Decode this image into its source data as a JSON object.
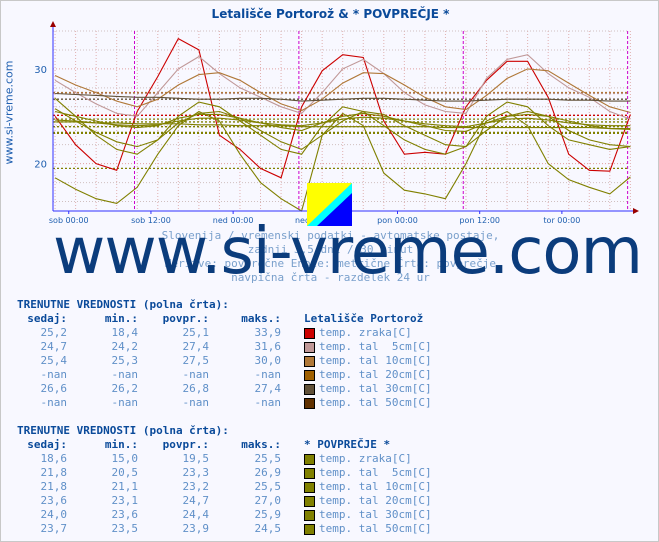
{
  "title": "Letališče Portorož & * POVPREČJE *",
  "side_text": "www.si-vreme.com",
  "watermark": "www.si-vreme.com",
  "captions": [
    "Slovenija / vremenski podatki - avtomatske postaje,",
    "zadnji 3,5 dni / 30 minut",
    "Meritve: povprečne  Enote: metrične  Črta: povprečje",
    "navpična črta - razdelek 24 ur"
  ],
  "chart_data": {
    "type": "line",
    "ylim": [
      15,
      34
    ],
    "yticks": [
      20,
      30
    ],
    "xticks": [
      "sob 00:00",
      "sob 12:00",
      "ned 00:00",
      "ned 12:00",
      "pon 00:00",
      "pon 12:00",
      "tor 00:00"
    ],
    "day_divider_times": [
      "sob 09:36",
      "ned 09:36",
      "pon 09:36",
      "tor 09:36"
    ],
    "grid": true,
    "x": [
      "pet 22:00",
      "sob 01:00",
      "sob 04:00",
      "sob 07:00",
      "sob 10:00",
      "sob 13:00",
      "sob 16:00",
      "sob 19:00",
      "sob 22:00",
      "ned 01:00",
      "ned 04:00",
      "ned 07:00",
      "ned 10:00",
      "ned 13:00",
      "ned 16:00",
      "ned 19:00",
      "ned 22:00",
      "pon 01:00",
      "pon 04:00",
      "pon 07:00",
      "pon 10:00",
      "pon 13:00",
      "pon 16:00",
      "pon 19:00",
      "pon 22:00",
      "tor 01:00",
      "tor 04:00",
      "tor 07:00",
      "tor 10:00"
    ],
    "series": [
      {
        "name": "Letališče Portorož temp. zraka[C]",
        "color": "#cc0000",
        "avg": 25.1,
        "values": [
          25.0,
          22.0,
          20.0,
          19.3,
          25.5,
          29.2,
          33.2,
          32.0,
          23.0,
          21.5,
          19.5,
          18.5,
          26.0,
          29.8,
          31.5,
          31.2,
          24.5,
          21.0,
          21.2,
          21.0,
          26.0,
          28.8,
          30.8,
          30.8,
          27.0,
          21.0,
          19.3,
          19.2,
          25.2
        ]
      },
      {
        "name": "Letališče Portorož temp. tal 5cm[C]",
        "color": "#c09898",
        "avg": 27.4,
        "values": [
          28.8,
          27.5,
          26.3,
          25.3,
          25.0,
          27.5,
          30.0,
          31.3,
          29.5,
          28.0,
          27.0,
          26.0,
          25.3,
          27.5,
          30.0,
          31.0,
          29.5,
          27.5,
          26.2,
          25.5,
          25.3,
          29.0,
          31.0,
          31.5,
          29.5,
          28.0,
          27.0,
          25.5,
          24.7
        ]
      },
      {
        "name": "Letališče Portorož temp. tal 10cm[C]",
        "color": "#b07838",
        "avg": 27.5,
        "values": [
          29.3,
          28.3,
          27.5,
          26.6,
          26.0,
          26.8,
          28.3,
          29.4,
          29.6,
          28.8,
          27.5,
          26.3,
          25.6,
          26.8,
          28.5,
          29.6,
          29.5,
          28.3,
          27.0,
          26.0,
          25.7,
          27.2,
          29.0,
          30.0,
          29.8,
          28.5,
          27.2,
          26.0,
          25.4
        ]
      },
      {
        "name": "Letališče Portorož temp. tal 30cm[C]",
        "color": "#605038",
        "avg": 26.8,
        "values": [
          27.4,
          27.3,
          27.2,
          27.1,
          27.0,
          27.0,
          26.9,
          26.8,
          26.8,
          26.9,
          26.9,
          26.8,
          26.6,
          26.7,
          26.8,
          26.9,
          26.9,
          26.8,
          26.7,
          26.6,
          26.6,
          26.7,
          26.8,
          26.8,
          26.8,
          26.7,
          26.7,
          26.6,
          26.6
        ]
      },
      {
        "name": "* POVPREČJE * temp. zraka[C]",
        "color": "#808000",
        "avg": 19.5,
        "values": [
          18.5,
          17.3,
          16.3,
          15.8,
          17.5,
          21.0,
          24.0,
          25.5,
          24.5,
          21.0,
          18.0,
          16.3,
          15.0,
          23.0,
          25.3,
          24.0,
          19.0,
          17.2,
          16.8,
          16.3,
          20.0,
          24.5,
          25.5,
          24.0,
          20.0,
          18.3,
          17.5,
          16.8,
          18.6
        ]
      },
      {
        "name": "* POVPREČJE * temp. tal 5cm[C]",
        "color": "#808000",
        "avg": 23.3,
        "values": [
          26.9,
          25.0,
          23.0,
          21.5,
          21.0,
          22.5,
          25.0,
          26.5,
          26.0,
          24.5,
          23.0,
          21.5,
          21.0,
          24.0,
          26.0,
          25.5,
          24.0,
          22.5,
          21.5,
          21.0,
          21.8,
          25.0,
          26.5,
          26.0,
          24.0,
          22.5,
          22.0,
          21.5,
          21.8
        ]
      },
      {
        "name": "* POVPREČJE * temp. tal 10cm[C]",
        "color": "#808000",
        "avg": 23.2,
        "values": [
          25.8,
          24.5,
          23.3,
          22.3,
          21.8,
          22.5,
          24.3,
          25.3,
          25.5,
          24.8,
          23.5,
          22.3,
          21.5,
          23.0,
          24.5,
          25.5,
          25.2,
          24.0,
          23.0,
          22.0,
          21.8,
          23.5,
          25.0,
          25.5,
          25.0,
          23.5,
          22.5,
          22.0,
          21.8
        ]
      },
      {
        "name": "* POVPREČJE * temp. tal 20cm[C]",
        "color": "#808000",
        "avg": 24.7,
        "values": [
          25.5,
          25.0,
          24.5,
          24.0,
          23.8,
          24.0,
          24.8,
          25.2,
          25.2,
          24.8,
          24.3,
          23.8,
          23.5,
          24.3,
          25.0,
          25.3,
          25.0,
          24.5,
          24.0,
          23.5,
          23.4,
          24.3,
          25.0,
          25.2,
          25.0,
          24.5,
          24.0,
          23.7,
          23.6
        ]
      },
      {
        "name": "* POVPREČJE * temp. tal 30cm[C]",
        "color": "#808000",
        "avg": 24.4,
        "values": [
          24.6,
          24.5,
          24.3,
          24.1,
          24.0,
          24.1,
          24.5,
          24.8,
          24.8,
          24.6,
          24.3,
          24.1,
          24.0,
          24.3,
          24.7,
          24.9,
          24.8,
          24.5,
          24.2,
          24.0,
          23.9,
          24.3,
          24.7,
          24.8,
          24.6,
          24.3,
          24.1,
          24.0,
          24.0
        ]
      },
      {
        "name": "* POVPREČJE * temp. tal 50cm[C]",
        "color": "#808000",
        "avg": 23.9,
        "values": [
          24.4,
          24.4,
          24.3,
          24.3,
          24.2,
          24.2,
          24.2,
          24.1,
          24.1,
          24.0,
          24.0,
          24.0,
          23.9,
          23.9,
          23.9,
          23.9,
          23.9,
          23.9,
          23.9,
          23.8,
          23.8,
          23.8,
          23.8,
          23.8,
          23.8,
          23.8,
          23.8,
          23.7,
          23.7
        ]
      }
    ]
  },
  "tables": [
    {
      "heading": "TRENUTNE VREDNOSTI (polna črta):",
      "cols": [
        "sedaj:",
        "min.:",
        "povpr.:",
        "maks.:"
      ],
      "station": "Letališče Portorož",
      "rows": [
        [
          "25,2",
          "18,4",
          "25,1",
          "33,9",
          "#cc0000",
          "temp. zraka[C]"
        ],
        [
          "24,7",
          "24,2",
          "27,4",
          "31,6",
          "#c09898",
          "temp. tal  5cm[C]"
        ],
        [
          "25,4",
          "25,3",
          "27,5",
          "30,0",
          "#b07838",
          "temp. tal 10cm[C]"
        ],
        [
          "-nan",
          "-nan",
          "-nan",
          "-nan",
          "#a06000",
          "temp. tal 20cm[C]"
        ],
        [
          "26,6",
          "26,2",
          "26,8",
          "27,4",
          "#605038",
          "temp. tal 30cm[C]"
        ],
        [
          "-nan",
          "-nan",
          "-nan",
          "-nan",
          "#603000",
          "temp. tal 50cm[C]"
        ]
      ]
    },
    {
      "heading": "TRENUTNE VREDNOSTI (polna črta):",
      "cols": [
        "sedaj:",
        "min.:",
        "povpr.:",
        "maks.:"
      ],
      "station": "* POVPREČJE *",
      "rows": [
        [
          "18,6",
          "15,0",
          "19,5",
          "25,5",
          "#808000",
          "temp. zraka[C]"
        ],
        [
          "21,8",
          "20,5",
          "23,3",
          "26,9",
          "#808000",
          "temp. tal  5cm[C]"
        ],
        [
          "21,8",
          "21,1",
          "23,2",
          "25,5",
          "#808000",
          "temp. tal 10cm[C]"
        ],
        [
          "23,6",
          "23,1",
          "24,7",
          "27,0",
          "#808000",
          "temp. tal 20cm[C]"
        ],
        [
          "24,0",
          "23,6",
          "24,4",
          "25,9",
          "#808000",
          "temp. tal 30cm[C]"
        ],
        [
          "23,7",
          "23,5",
          "23,9",
          "24,5",
          "#808000",
          "temp. tal 50cm[C]"
        ]
      ]
    }
  ]
}
